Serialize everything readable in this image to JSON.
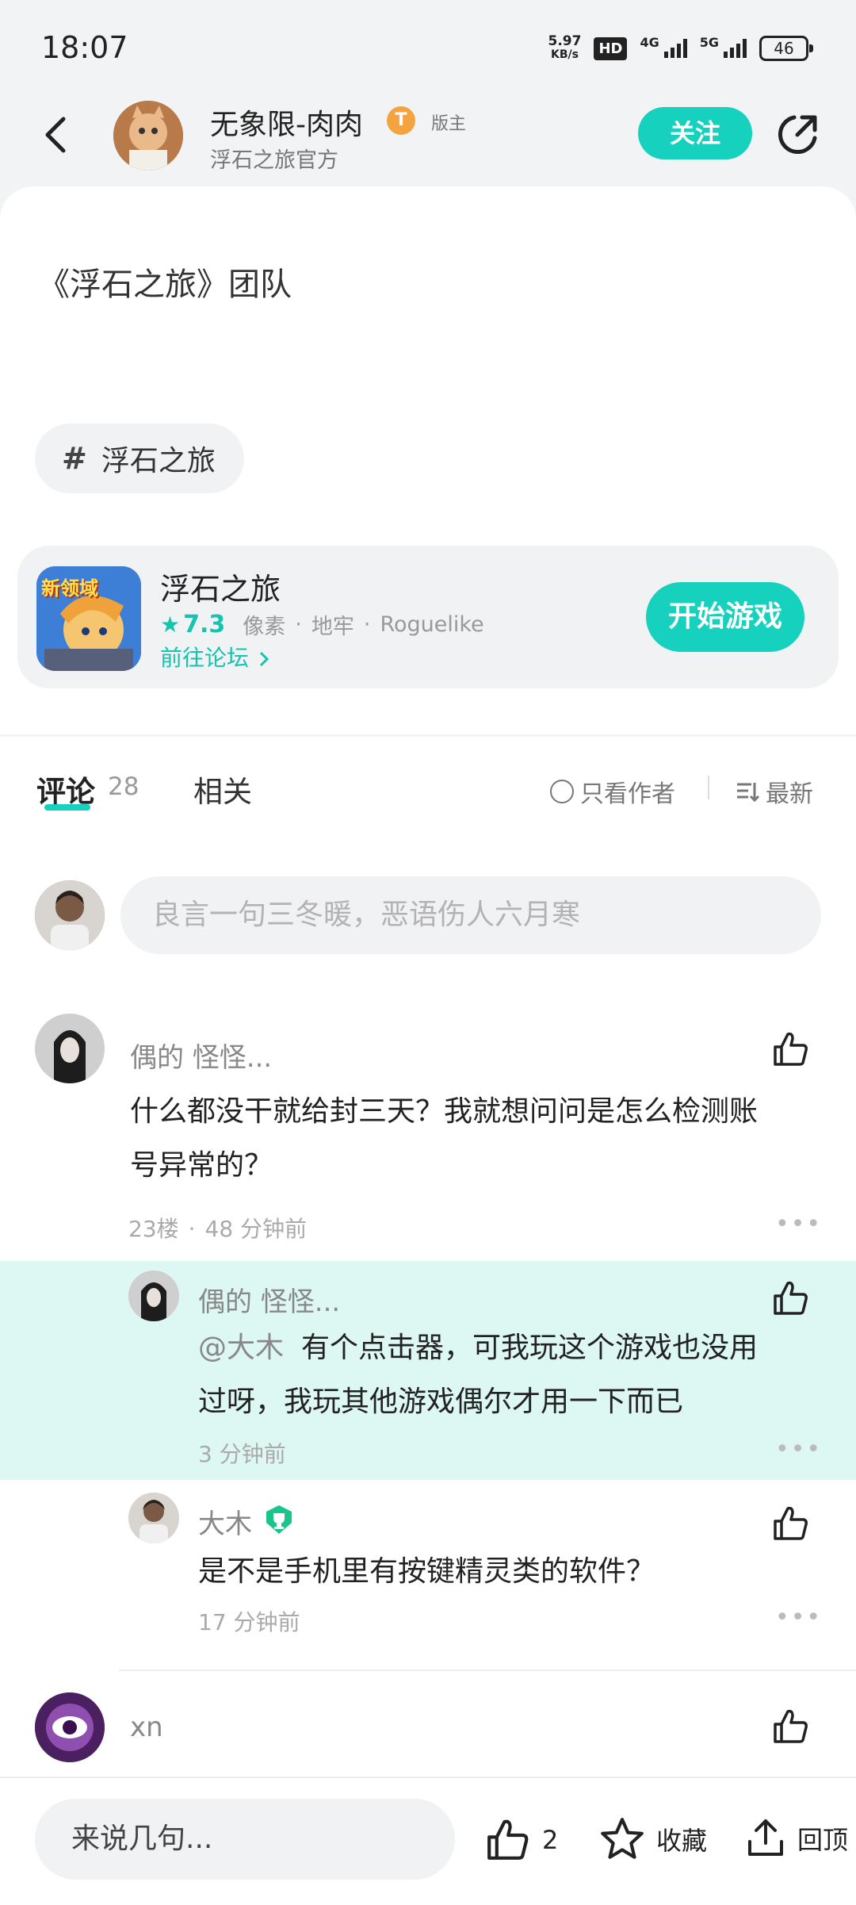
{
  "status_bar": {
    "time": "18:07",
    "speed_value": "5.97",
    "speed_unit": "KB/s",
    "hd_label": "HD",
    "net1": "4G",
    "net2": "5G",
    "battery": "46"
  },
  "header": {
    "author_name": "无象限-肉肉",
    "level_badge": "T",
    "moderator_tag": "版主",
    "author_subtitle": "浮石之旅官方",
    "follow_label": "关注"
  },
  "post": {
    "text": "《浮石之旅》团队",
    "topic_tag": "浮石之旅"
  },
  "game_card": {
    "title": "浮石之旅",
    "rating": "7.3",
    "tags": [
      "像素",
      "地牢",
      "Roguelike"
    ],
    "forum_link": "前往论坛",
    "start_label": "开始游戏",
    "icon_text": "新领域"
  },
  "tabs": {
    "comments_label": "评论",
    "comments_count": "28",
    "related_label": "相关",
    "author_only_label": "只看作者",
    "sort_label": "最新"
  },
  "comment_input": {
    "placeholder": "良言一句三冬暖，恶语伤人六月寒"
  },
  "comments": [
    {
      "name": "偶的 怪怪...",
      "text_line1": "什么都没干就给封三天？我就想问问是怎么检测账",
      "text_line2": "号异常的？",
      "floor": "23楼",
      "time": "48 分钟前"
    },
    {
      "name": "偶的 怪怪...",
      "mention": "@大木",
      "text_line1": "有个点击器，可我玩这个游戏也没用",
      "text_line2": "过呀，我玩其他游戏偶尔才用一下而已",
      "time": "3 分钟前"
    },
    {
      "name": "大木",
      "text_line1": "是不是手机里有按键精灵类的软件？",
      "time": "17 分钟前"
    },
    {
      "name": "xn"
    }
  ],
  "bottom_bar": {
    "input_placeholder": "来说几句...",
    "like_count": "2",
    "favorite_label": "收藏",
    "top_label": "回顶"
  },
  "colors": {
    "accent": "#16d1bd",
    "highlight": "#ddf7f3"
  }
}
